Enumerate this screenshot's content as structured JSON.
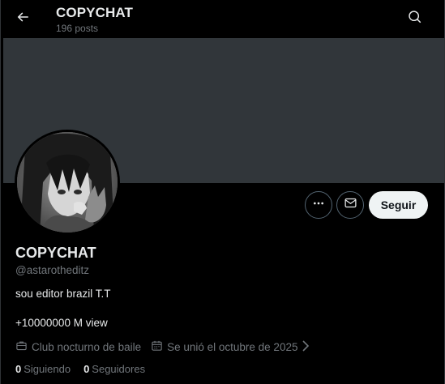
{
  "header": {
    "title": "COPYCHAT",
    "post_count": "196 posts",
    "back_icon": "arrow-left-icon",
    "search_icon": "search-icon"
  },
  "banner": {
    "color": "#31363a"
  },
  "actions": {
    "more_icon": "more-dots-icon",
    "message_icon": "mail-icon",
    "follow_label": "Seguir"
  },
  "profile": {
    "display_name": "COPYCHAT",
    "handle": "@astarotheditz",
    "bio_line1": "sou editor brazil T.T",
    "bio_line2": "+10000000 M view",
    "category": "Club nocturno de baile",
    "category_icon": "briefcase-icon",
    "joined": "Se unió el octubre de 2025",
    "joined_icon": "calendar-icon"
  },
  "stats": {
    "following_count": "0",
    "following_label": "Siguiendo",
    "followers_count": "0",
    "followers_label": "Seguidores"
  }
}
